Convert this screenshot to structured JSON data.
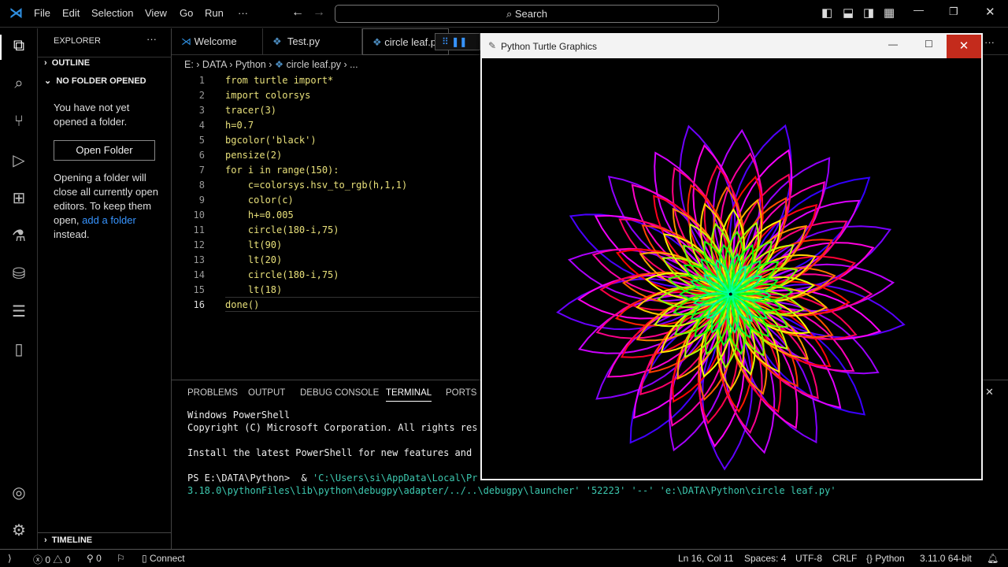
{
  "menu": [
    "File",
    "Edit",
    "Selection",
    "View",
    "Go",
    "Run",
    "···"
  ],
  "search": "Search",
  "sidebar": {
    "title": "EXPLORER",
    "outline": "OUTLINE",
    "no_folder": "NO FOLDER OPENED",
    "msg1": "You have not yet opened a folder.",
    "open_btn": "Open Folder",
    "msg2": "Opening a folder will close all currently open editors. To keep them open,",
    "link": "add a folder",
    "msg3": "instead.",
    "timeline": "TIMELINE"
  },
  "tabs": [
    "Welcome",
    "Test.py",
    "circle leaf.py"
  ],
  "breadcrumb": [
    "E:",
    "DATA",
    "Python",
    "circle leaf.py",
    "..."
  ],
  "code": [
    "from turtle import*",
    "import colorsys",
    "tracer(3)",
    "h=0.7",
    "bgcolor('black')",
    "pensize(2)",
    "for i in range(150):",
    "    c=colorsys.hsv_to_rgb(h,1,1)",
    "    color(c)",
    "    h+=0.005",
    "    circle(180-i,75)",
    "    lt(90)",
    "    lt(20)",
    "    circle(180-i,75)",
    "    lt(18)",
    "done()"
  ],
  "panel_tabs": [
    "PROBLEMS",
    "OUTPUT",
    "DEBUG CONSOLE",
    "TERMINAL",
    "PORTS"
  ],
  "terminal": {
    "l1": "Windows PowerShell",
    "l2": "Copyright (C) Microsoft Corporation. All rights res",
    "l3": "Install the latest PowerShell for new features and",
    "prompt": "PS E:\\DATA\\Python>  & ",
    "cmd1": "'C:\\Users\\si\\AppData\\Local\\Pr",
    "cmd2": "3.18.0\\pythonFiles\\lib\\python\\debugpy\\adapter/../..\\debugpy\\launcher' '52223' '--' 'e:\\DATA\\Python\\circle leaf.py'"
  },
  "status": {
    "errors": "0",
    "warnings": "0",
    "ports": "0",
    "connect": "Connect",
    "pos": "Ln 16, Col 11",
    "spaces": "Spaces: 4",
    "enc": "UTF-8",
    "eol": "CRLF",
    "lang": "Python",
    "ver": "3.11.0 64-bit"
  },
  "turtle": {
    "title": "Python Turtle Graphics",
    "h0": 0.7,
    "dh": 0.005,
    "count": 150
  }
}
